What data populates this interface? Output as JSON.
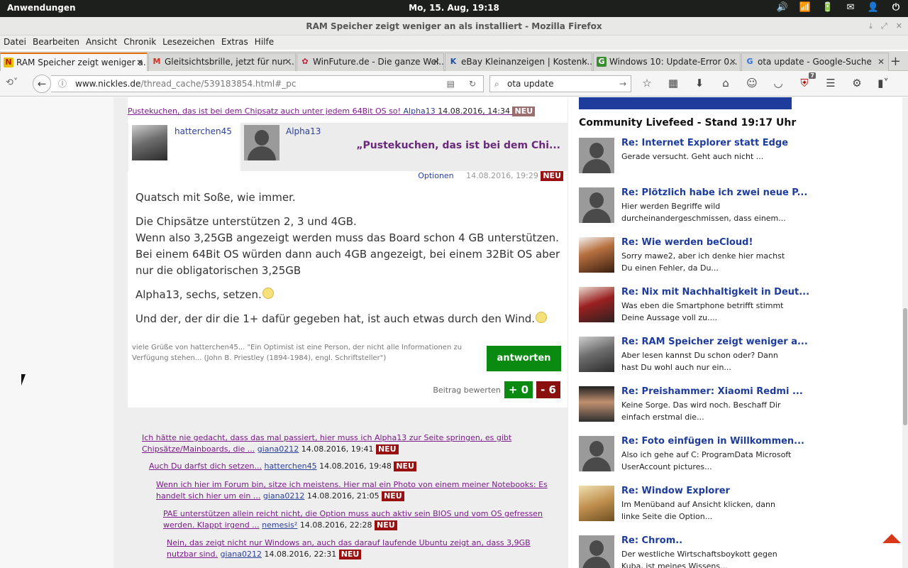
{
  "topbar": {
    "apps": "Anwendungen",
    "clock": "Mo, 15. Aug, 19:18",
    "tray": [
      "🔊",
      "📶",
      "🔋",
      "✉",
      "👤",
      "⏻"
    ]
  },
  "window": {
    "title": "RAM Speicher zeigt weniger an als installiert - Mozilla Firefox"
  },
  "menu": [
    "Datei",
    "Bearbeiten",
    "Ansicht",
    "Chronik",
    "Lesezeichen",
    "Extras",
    "Hilfe"
  ],
  "tabs": [
    {
      "label": "RAM Speicher zeigt weniger a...",
      "fav": "N",
      "favbg": "#e8c000",
      "favfg": "#c01010",
      "active": true
    },
    {
      "label": "Gleitsichtsbrille, jetzt für nur ...",
      "fav": "M",
      "favbg": "#ffffff",
      "favfg": "#d03020"
    },
    {
      "label": "WinFuture.de - Die ganze Wel...",
      "fav": "✿",
      "favbg": "#ffffff",
      "favfg": "#c02040"
    },
    {
      "label": "eBay Kleinanzeigen | Kostenl...",
      "fav": "K",
      "favbg": "#ffffff",
      "favfg": "#2050a0"
    },
    {
      "label": "Windows 10: Update-Error 0...",
      "fav": "G",
      "favbg": "#3a8a30",
      "favfg": "#ffffff"
    },
    {
      "label": "ota update - Google-Suche",
      "fav": "G",
      "favbg": "#ffffff",
      "favfg": "#3070e0"
    }
  ],
  "nav": {
    "url_host": "www.nickles.de",
    "url_path": "/thread_cache/539183854.html#_pc",
    "search_value": "ota update",
    "ublock_count": "7"
  },
  "post": {
    "quote_link": "Pustekuchen, das ist bei dem Chipsatz auch unter jedem 64Bit OS so!",
    "quote_author": "Alpha13",
    "quote_date": "14.08.2016, 14:34",
    "neu": "NEU",
    "author": "hatterchen45",
    "quoted_author": "Alpha13",
    "quoted_text": "„Pustekuchen, das ist bei dem Chi...",
    "options": "Optionen",
    "date": "14.08.2016, 19:29",
    "body": {
      "p1": "Quatsch mit Soße, wie immer.",
      "p2a": "Die Chipsätze unterstützen 2, 3 und 4GB.",
      "p2b": "Wenn also 3,25GB angezeigt werden muss das Board schon 4 GB unterstützen. Bei einem 64Bit OS würden dann auch 4GB angezeigt, bei einem 32Bit OS aber nur die obligatorischen 3,25GB",
      "p3": "Alpha13, sechs, setzen.",
      "p4": "Und der, der dir die 1+ dafür gegeben hat, ist auch etwas durch den Wind."
    },
    "signature": "viele Grüße von hatterchen45... \"Ein Optimist ist eine Person, der nicht alle Informationen zu Verfügung stehen... (John B. Priestley (1894-1984), engl. Schriftsteller\")",
    "reply": "antworten",
    "rate_label": "Beitrag bewerten",
    "plus": "+ 0",
    "minus": "- 6"
  },
  "thread": [
    {
      "text": "Ich hätte nie gedacht, dass das mal passiert, hier muss ich Alpha13 zur Seite springen, es gibt Chipsätze/Mainboards, die ...",
      "author": "giana0212",
      "date": "14.08.2016, 19:41"
    },
    {
      "text": "Auch Du darfst dich setzen...",
      "author": "hatterchen45",
      "date": "14.08.2016, 19:48"
    },
    {
      "text": "Wenn ich hier im Forum bin, sitze ich meistens. Hier mal ein Photo von einem meiner Notebooks: Es handelt sich hier um ein ...",
      "author": "giana0212",
      "date": "14.08.2016, 21:05"
    },
    {
      "text": "PAE unterstützen allein reicht nicht, die Option muss auch aktiv sein BIOS und vom OS gefressen werden. Klappt irgend ...",
      "author": "nemesis²",
      "date": "14.08.2016, 22:28"
    },
    {
      "text": "Nein, das zeigt nicht nur Windows an, auch das darauf laufende Ubuntu zeigt an, dass 3,9GB nutzbar sind.",
      "author": "giana0212",
      "date": "14.08.2016, 22:31"
    }
  ],
  "sidebar": {
    "title": "Community Livefeed - Stand 19:17 Uhr",
    "items": [
      {
        "title": "Re: Internet Explorer statt Edge",
        "snippet": "Gerade versucht. Geht auch nicht ...",
        "avatar": "ghost"
      },
      {
        "title": "Re: Plötzlich habe ich zwei neue P...",
        "snippet": "Hier werden Begriffe wild durcheinandergeschmissen, dass einem...",
        "avatar": "ghost"
      },
      {
        "title": "Re: Wie werden beCloud!",
        "snippet": "Sorry mawe2, aber ich denke hier machst Du einen Fehler, da Du...",
        "avatar": "dog"
      },
      {
        "title": "Re: Nix mit Nachhaltigkeit in Deut...",
        "snippet": "Was eben die Smartphone betrifft stimmt Deine Aussage voll zu....",
        "avatar": "hat"
      },
      {
        "title": "Re: RAM Speicher zeigt weniger a...",
        "snippet": "Aber lesen kannst Du schon oder? Dann hast Du wohl auch nur ein...",
        "avatar": "photo"
      },
      {
        "title": "Re: Preishammer: Xiaomi Redmi ...",
        "snippet": "Keine Sorge. Das wird noch. Beschaff Dir einfach erstmal die...",
        "avatar": "hair"
      },
      {
        "title": "Re: Foto einfügen in Willkommen...",
        "snippet": "Also ich gehe auf C: ProgramData Microsoft UserAccount pictures...",
        "avatar": "ghost"
      },
      {
        "title": "Re: Window Explorer",
        "snippet": "Im Menüband auf Ansicht klicken, dann linke Seite die Option...",
        "avatar": "carve"
      },
      {
        "title": "Re: Chrom..",
        "snippet": "Der westliche Wirtschaftsboykott gegen Kuba, ist meines Wissens...",
        "avatar": "ghost"
      }
    ]
  }
}
